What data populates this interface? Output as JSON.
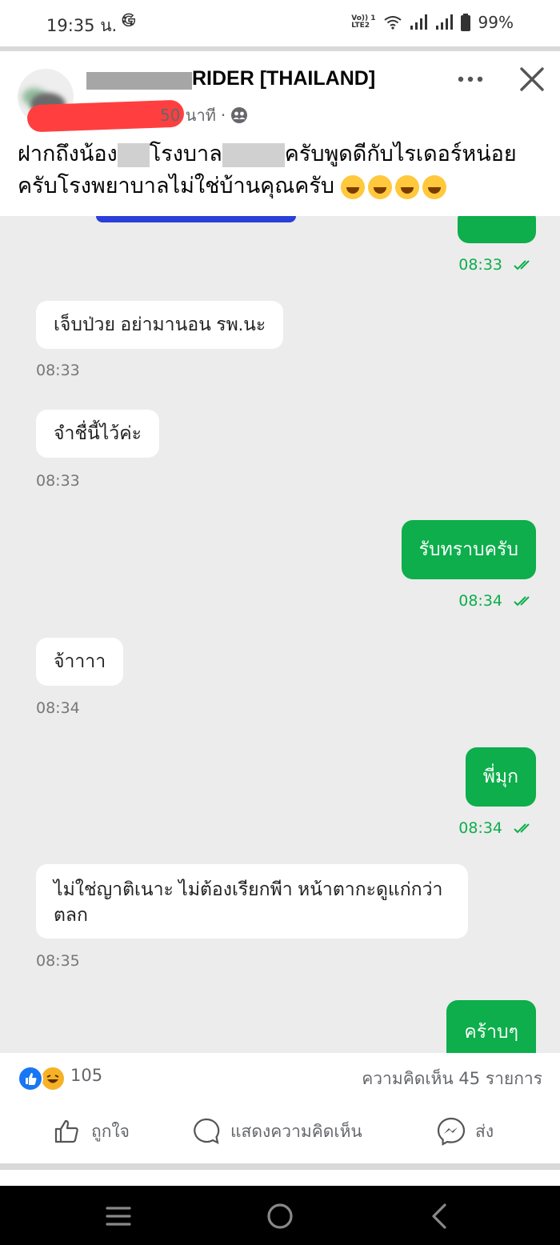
{
  "status_bar": {
    "time": "19:35 น.",
    "lte_top": "Vo)) 1",
    "lte_bottom": "LTE2",
    "battery": "99%"
  },
  "post": {
    "author_suffix": "RIDER [THAILAND]",
    "time_ago": "50 นาที",
    "caption_line1_a": "ฝากถึงน้อง",
    "caption_line1_b": "โรงบาล",
    "caption_line1_c": "ครับพูดดีกับไรเดอร์หน่อย",
    "caption_line2": "ครับโรงพยาบาลไม่ใช่บ้านคุณครับ"
  },
  "chat": {
    "messages": [
      {
        "side": "out",
        "text": "",
        "time": "08:33"
      },
      {
        "side": "in",
        "text": "เจ็บป่วย อย่ามานอน รพ.นะ",
        "time": "08:33"
      },
      {
        "side": "in",
        "text": "จำชื่นี้ไว้ค่ะ",
        "time": "08:33"
      },
      {
        "side": "out",
        "text": "รับทราบครับ",
        "time": "08:34"
      },
      {
        "side": "in",
        "text": "จ้าาาา",
        "time": "08:34"
      },
      {
        "side": "out",
        "text": "พี่มุก",
        "time": "08:34"
      },
      {
        "side": "in",
        "text_line1": "ไม่ใช่ญาติเนาะ ไม่ต้องเรียกพีา หน้าตากะดูแก่กว่า",
        "text_line2": "ตลก",
        "time": "08:35"
      },
      {
        "side": "out",
        "text": "คร้าบๆ"
      }
    ]
  },
  "reactions": {
    "count": "105",
    "comments": "ความคิดเห็น 45 รายการ"
  },
  "actions": {
    "like": "ถูกใจ",
    "comment": "แสดงความคิดเห็น",
    "send": "ส่ง"
  },
  "colors": {
    "outgoing_bubble": "#0dae4b",
    "chat_bg": "#ececec",
    "like_blue": "#1877f2"
  }
}
